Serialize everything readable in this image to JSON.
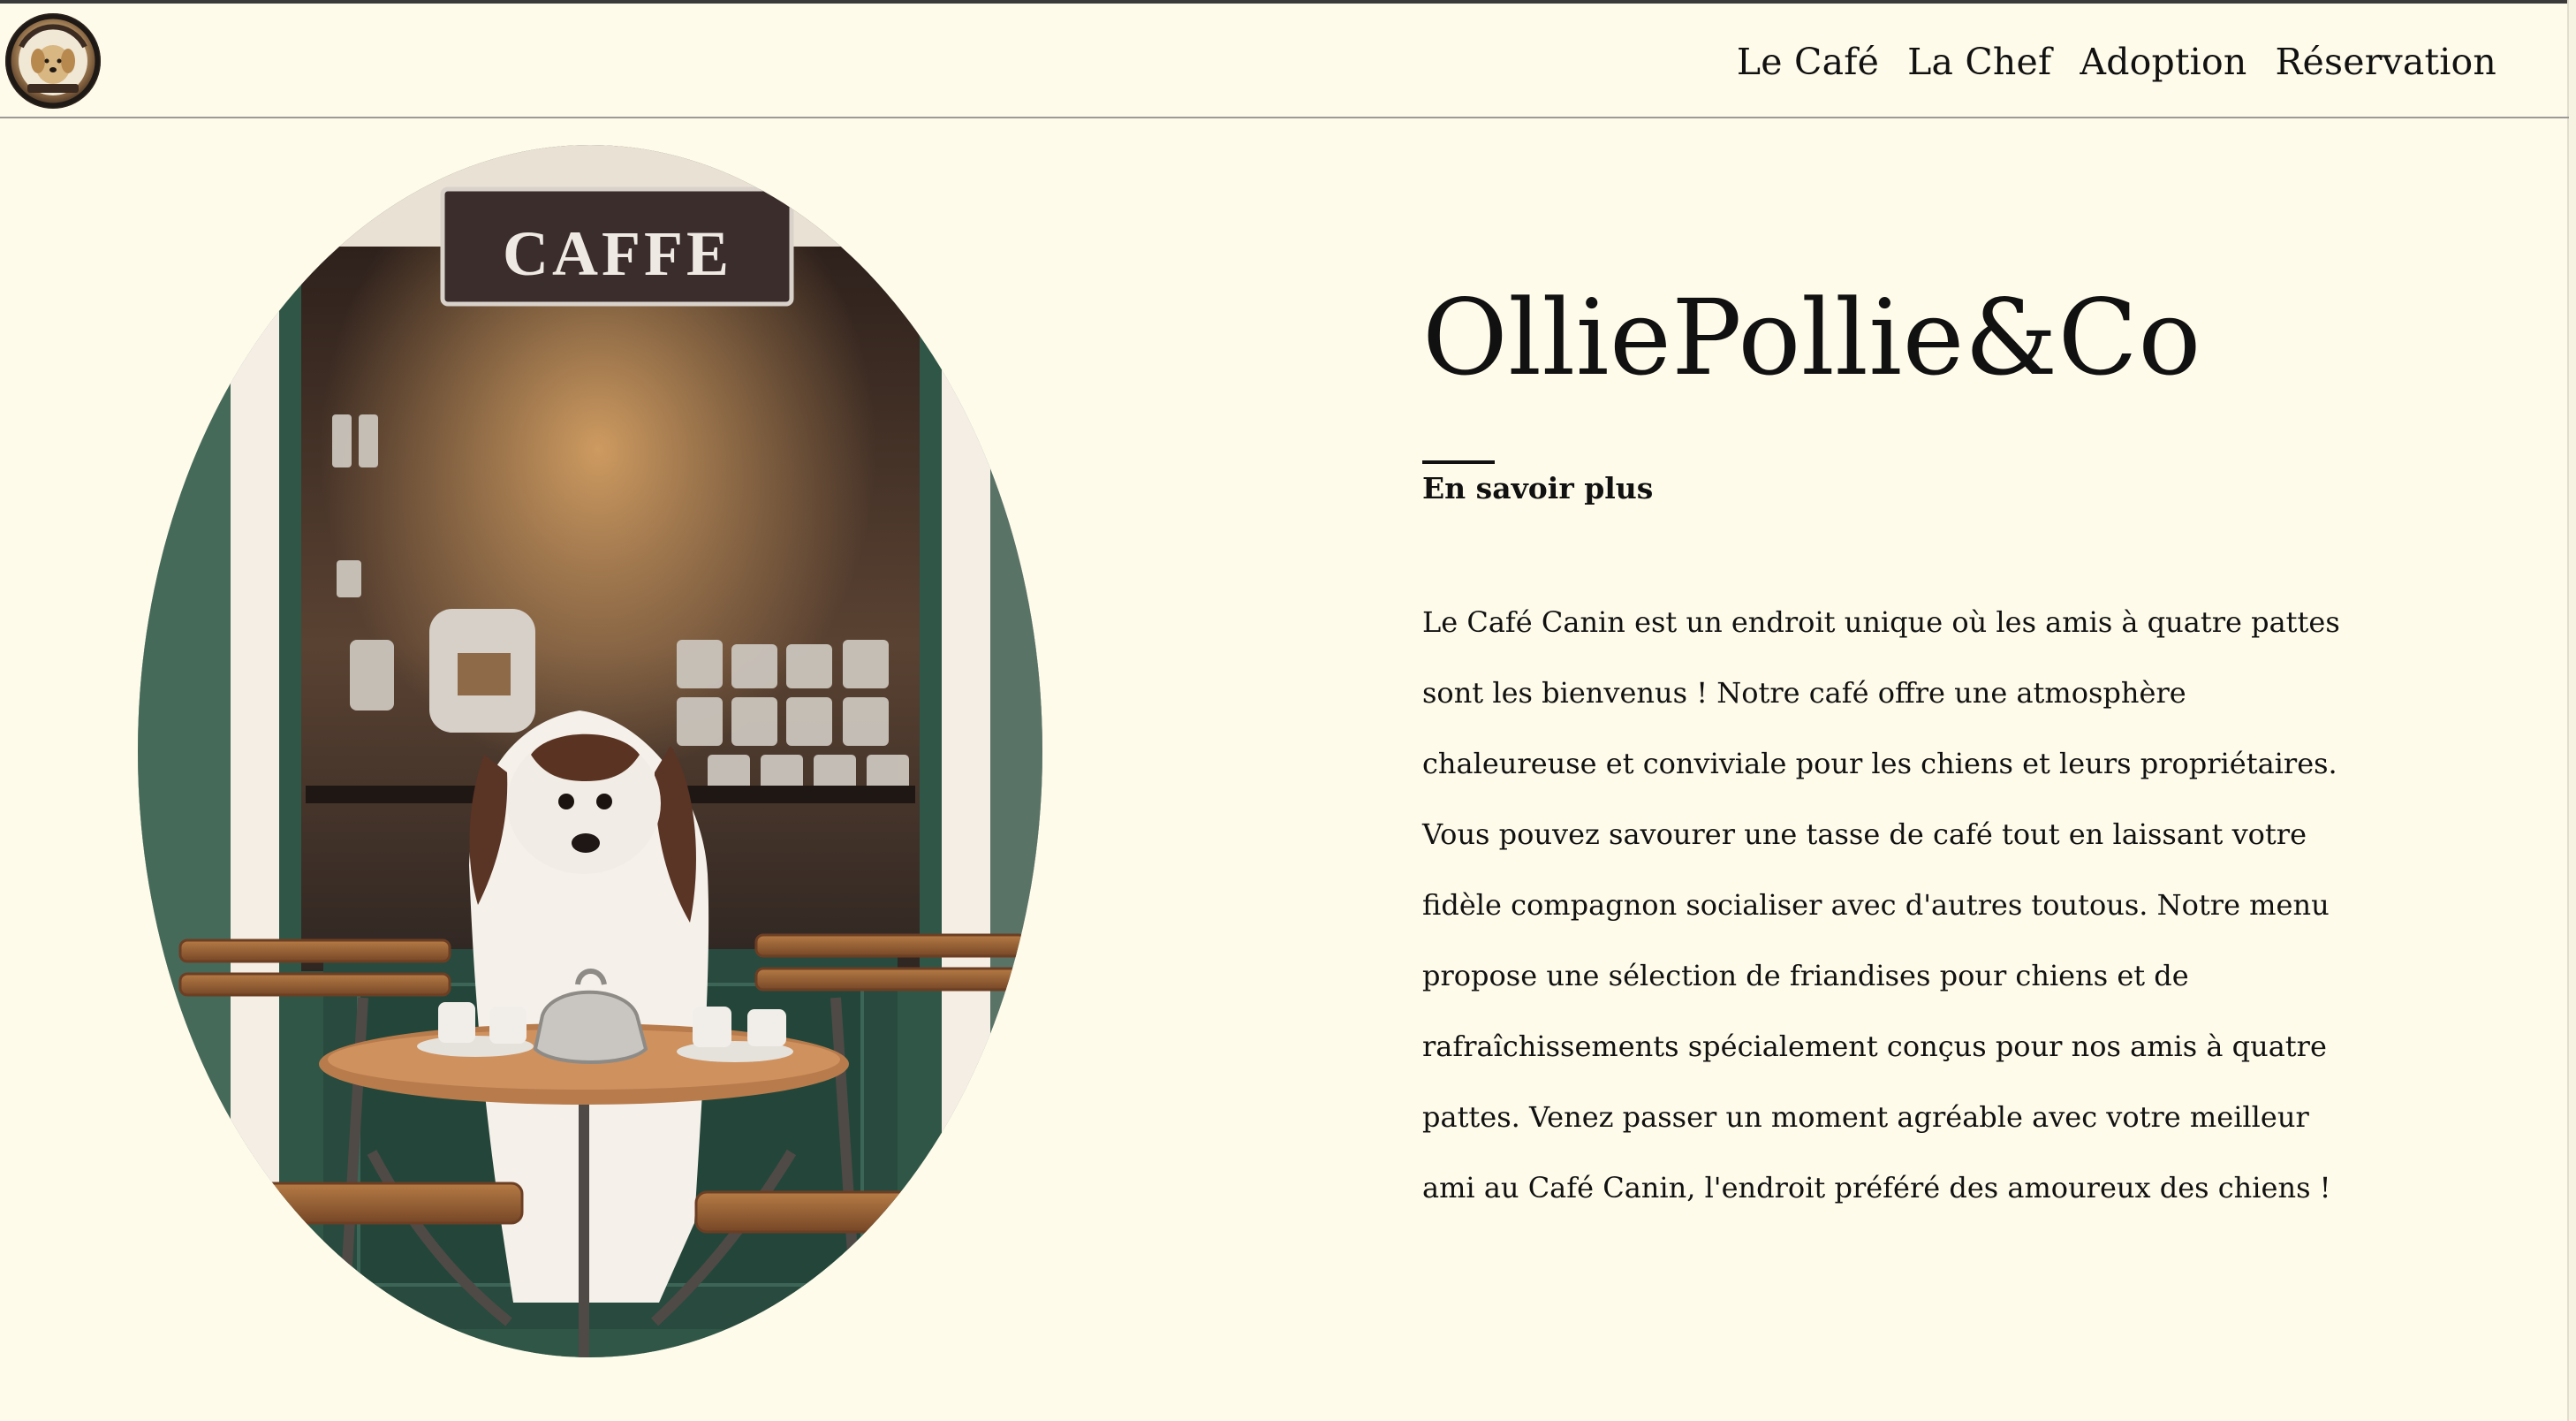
{
  "header": {
    "logo_icon": "dog-cafe-badge-logo",
    "nav": [
      {
        "label": "Le Café"
      },
      {
        "label": "La Chef"
      },
      {
        "label": "Adoption"
      },
      {
        "label": "Réservation"
      }
    ]
  },
  "hero": {
    "image_sign_text": "CAFFE",
    "title": "OlliePollie&Co",
    "more_link": "En savoir plus",
    "description_lines": [
      "Le Café Canin est un endroit unique où les amis à quatre pattes",
      "sont les bienvenus ! Notre café offre une atmosphère",
      "chaleureuse et conviviale pour les chiens et leurs propriétaires.",
      "Vous pouvez savourer une tasse de café tout en laissant votre",
      "fidèle compagnon socialiser avec d'autres toutous. Notre menu",
      "propose une sélection de friandises pour chiens et de",
      "rafraîchissements spécialement conçus pour nos amis à quatre",
      "pattes. Venez passer un moment agréable avec votre meilleur",
      "ami au Café Canin, l'endroit préféré des amoureux des chiens !"
    ]
  },
  "colors": {
    "background": "#fefbea",
    "text": "#111111",
    "divider": "#9b9b98",
    "cafe_green": "#2f4c42"
  }
}
